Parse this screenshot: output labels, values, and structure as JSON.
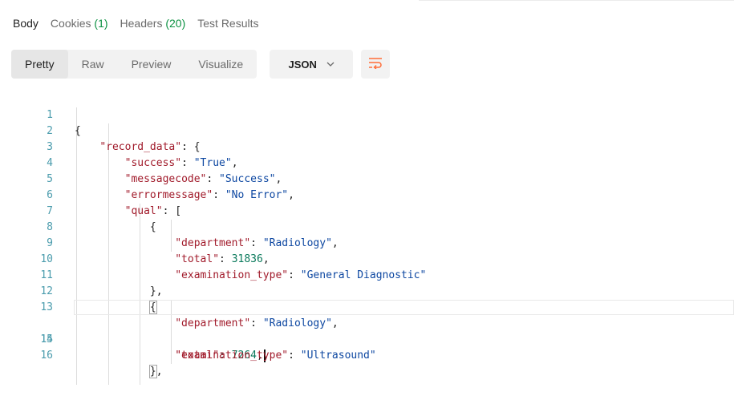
{
  "response_tabs": {
    "body": "Body",
    "cookies": {
      "label": "Cookies",
      "count": "(1)"
    },
    "headers": {
      "label": "Headers",
      "count": "(20)"
    },
    "test_results": "Test Results"
  },
  "toolbar": {
    "pretty": "Pretty",
    "raw": "Raw",
    "preview": "Preview",
    "visualize": "Visualize",
    "format": "JSON"
  },
  "icons": {
    "chevron": "chevron-down-icon",
    "wrap": "word-wrap-icon"
  },
  "colors": {
    "accent": "#ff6c37",
    "count_green": "#0c9142",
    "key": "#a11b2b",
    "string": "#0d47a1",
    "number": "#0b7a5c"
  },
  "code": {
    "line_numbers": [
      "1",
      "2",
      "3",
      "4",
      "5",
      "6",
      "7",
      "8",
      "9",
      "10",
      "11",
      "12",
      "13",
      "14",
      "15",
      "16"
    ],
    "keys": {
      "record_data": "\"record_data\"",
      "success": "\"success\"",
      "messagecode": "\"messagecode\"",
      "errormessage": "\"errormessage\"",
      "qual": "\"qual\"",
      "department": "\"department\"",
      "total": "\"total\"",
      "examination_type": "\"examination_type\""
    },
    "values": {
      "success": "\"True\"",
      "messagecode": "\"Success\"",
      "errormessage": "\"No Error\"",
      "department_1": "\"Radiology\"",
      "total_1": "31836",
      "examination_type_1": "\"General Diagnostic\"",
      "department_2": "\"Radiology\"",
      "total_2": "7264",
      "examination_type_2": "\"Ultrasound\""
    }
  }
}
